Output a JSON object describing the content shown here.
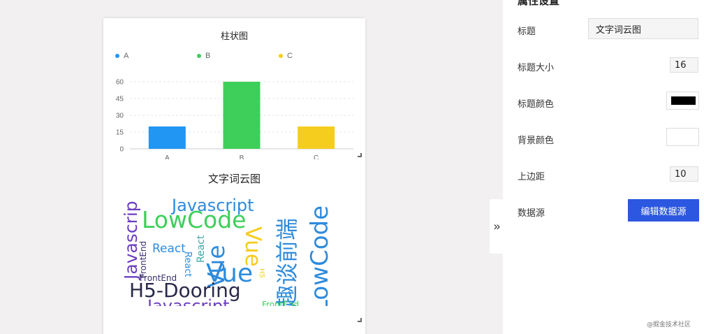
{
  "bar_chart": {
    "title": "柱状图",
    "legend": [
      {
        "label": "A",
        "color": "#2196f3"
      },
      {
        "label": "B",
        "color": "#3ecf5a"
      },
      {
        "label": "C",
        "color": "#f5cd1f"
      }
    ]
  },
  "chart_data": {
    "type": "bar",
    "title": "柱状图",
    "categories": [
      "A",
      "B",
      "C"
    ],
    "values": [
      20,
      60,
      20
    ],
    "colors": [
      "#2196f3",
      "#3ecf5a",
      "#f5cd1f"
    ],
    "y_ticks": [
      "0",
      "15",
      "30",
      "45",
      "60"
    ],
    "ylim": [
      0,
      60
    ],
    "grid": true,
    "legend_position": "top-left",
    "xlabel": "",
    "ylabel": ""
  },
  "word_cloud": {
    "title": "文字词云图",
    "words": [
      {
        "text": "Javascrip",
        "color": "#6b3fc0"
      },
      {
        "text": "Javascript",
        "color": "#2e8bdc"
      },
      {
        "text": "LowCode",
        "color": "#3ecf5a"
      },
      {
        "text": "React",
        "color": "#2e8bdc"
      },
      {
        "text": "React",
        "color": "#3ba6a6"
      },
      {
        "text": "FrontEnd",
        "color": "#3a2f6b"
      },
      {
        "text": "FrontEnd",
        "color": "#3a2f6b"
      },
      {
        "text": "React",
        "color": "#2e8bdc"
      },
      {
        "text": "Vue",
        "color": "#2e8bdc"
      },
      {
        "text": "Vue",
        "color": "#2e8bdc"
      },
      {
        "text": "Vue",
        "color": "#f5cd1f"
      },
      {
        "text": "H5",
        "color": "#f5cd1f"
      },
      {
        "text": "趣谈前端",
        "color": "#2e8bdc"
      },
      {
        "text": "LowCode",
        "color": "#2e8bdc"
      },
      {
        "text": "H5-Dooring",
        "color": "#2a2a4a"
      },
      {
        "text": "Javascript",
        "color": "#6b3fc0"
      },
      {
        "text": "FrontEnd",
        "color": "#3ecf5a"
      }
    ]
  },
  "panel": {
    "heading": "属性设置",
    "toggle_icon": "»",
    "title_label": "标题",
    "title_value": "文字词云图",
    "title_size_label": "标题大小",
    "title_size_value": "16",
    "title_color_label": "标题颜色",
    "title_color_value": "#000000",
    "bg_color_label": "背景颜色",
    "bg_color_value": "#ffffff",
    "margin_top_label": "上边距",
    "margin_top_value": "10",
    "datasource_label": "数据源",
    "edit_button": "编辑数据源"
  },
  "watermark": "@掘金技术社区"
}
